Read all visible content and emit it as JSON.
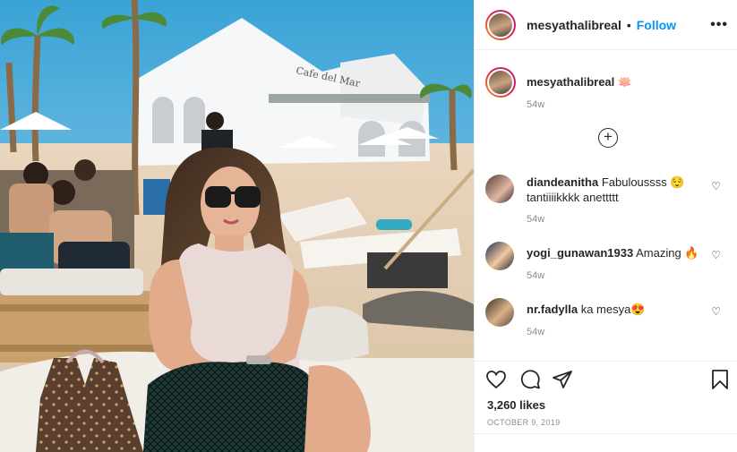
{
  "post": {
    "username": "mesyathalibreal",
    "follow_label": "Follow",
    "separator": "•",
    "more_icon": "•••",
    "caption_emoji": "🪷",
    "caption_time": "54w",
    "likes": "3,260 likes",
    "date": "OCTOBER 9, 2019",
    "photo_sign_text": "Cafe del Mar"
  },
  "comments": [
    {
      "user": "diandeanitha",
      "text": "Fabuloussss 😌 tantiiiikkkk anettttt",
      "time": "54w"
    },
    {
      "user": "yogi_gunawan1933",
      "text": "Amazing 🔥",
      "time": "54w"
    },
    {
      "user": "nr.fadylla",
      "text": "ka mesya😍",
      "time": "54w"
    }
  ],
  "colors": {
    "link": "#0095f6",
    "muted": "#8e8e8e",
    "text": "#262626"
  },
  "icons": [
    "heart-icon",
    "comment-icon",
    "share-icon",
    "bookmark-icon",
    "plus-circle-icon",
    "more-icon"
  ]
}
